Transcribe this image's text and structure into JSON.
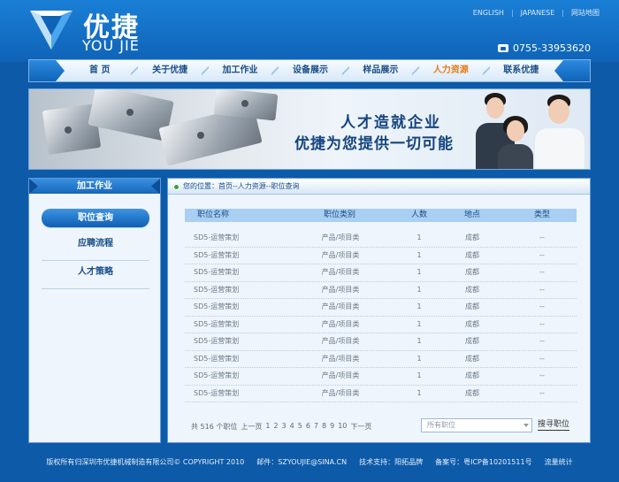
{
  "brand": {
    "cn_name": "优捷",
    "en_name": "YOU JIE",
    "phone": "0755-33953620"
  },
  "top_links": [
    {
      "label": "ENGLISH"
    },
    {
      "label": "JAPANESE"
    },
    {
      "label": "网站地图"
    }
  ],
  "nav": {
    "items": [
      {
        "label": "首  页",
        "active": false
      },
      {
        "label": "关于优捷",
        "active": false
      },
      {
        "label": "加工作业",
        "active": false
      },
      {
        "label": "设备展示",
        "active": false
      },
      {
        "label": "样品展示",
        "active": false
      },
      {
        "label": "人力资源",
        "active": true
      },
      {
        "label": "联系优捷",
        "active": false
      }
    ]
  },
  "banner": {
    "slogan_line1": "人才造就企业",
    "slogan_line2": "优捷为您提供一切可能"
  },
  "sidebar": {
    "title": "加工作业",
    "items": [
      {
        "label": "职位查询",
        "active": true
      },
      {
        "label": "应聘流程",
        "active": false
      },
      {
        "label": "人才策略",
        "active": false
      }
    ]
  },
  "main": {
    "breadcrumb": "您的位置：首页--人力资源--职位查询",
    "columns": [
      "职位名称",
      "职位类别",
      "人数",
      "地点",
      "类型"
    ],
    "rows": [
      [
        "SD5-运营策划",
        "产品/项目类",
        "1",
        "成都",
        "--"
      ],
      [
        "SD5-运营策划",
        "产品/项目类",
        "1",
        "成都",
        "--"
      ],
      [
        "SD5-运营策划",
        "产品/项目类",
        "1",
        "成都",
        "--"
      ],
      [
        "SD5-运营策划",
        "产品/项目类",
        "1",
        "成都",
        "--"
      ],
      [
        "SD5-运营策划",
        "产品/项目类",
        "1",
        "成都",
        "--"
      ],
      [
        "SD5-运营策划",
        "产品/项目类",
        "1",
        "成都",
        "--"
      ],
      [
        "SD5-运营策划",
        "产品/项目类",
        "1",
        "成都",
        "--"
      ],
      [
        "SD5-运营策划",
        "产品/项目类",
        "1",
        "成都",
        "--"
      ],
      [
        "SD5-运营策划",
        "产品/项目类",
        "1",
        "成都",
        "--"
      ],
      [
        "SD5-运营策划",
        "产品/项目类",
        "1",
        "成都",
        "--"
      ]
    ],
    "pager": {
      "total": "共 516 个职位",
      "prev": "上一页",
      "pages": [
        "1",
        "2",
        "3",
        "4",
        "5",
        "6",
        "7",
        "8",
        "9",
        "10"
      ],
      "next": "下一页"
    },
    "job_select": {
      "selected": "所有职位"
    },
    "search_label": "搜寻职位"
  },
  "footer": {
    "copyright": "版权所有归深圳市优捷机械制造有限公司© COPYRIGHT 2010",
    "email": "邮件：SZYOUJIE@SINA.CN",
    "tech": "技术支持：阳拓品牌",
    "icp": "备案号：粤ICP备10201511号",
    "stats": "流量统计"
  },
  "colors": {
    "brand_blue": "#0d5aa8",
    "nav_active": "#e87a1a",
    "table_header": "#a9cff2"
  }
}
